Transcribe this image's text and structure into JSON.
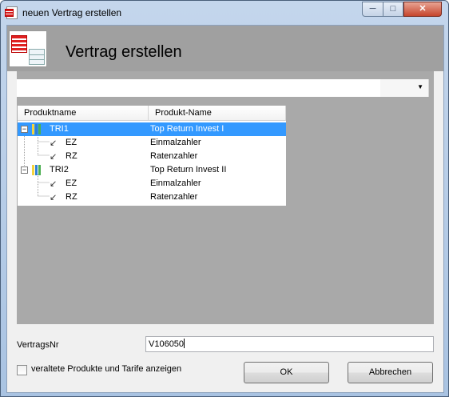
{
  "window": {
    "title": "neuen Vertrag erstellen",
    "controls": {
      "minimize": "─",
      "maximize": "□",
      "close": "✕"
    }
  },
  "header": {
    "title": "Vertrag erstellen"
  },
  "combo": {
    "value": "",
    "arrow": "▼"
  },
  "tree": {
    "columns": [
      "Produktname",
      "Produkt-Name"
    ],
    "rows": [
      {
        "name": "TRI1",
        "desc": "Top Return Invest I",
        "level": 0,
        "expander": "−",
        "selected": true
      },
      {
        "name": "EZ",
        "desc": "Einmalzahler",
        "level": 1
      },
      {
        "name": "RZ",
        "desc": "Ratenzahler",
        "level": 1
      },
      {
        "name": "TRI2",
        "desc": "Top Return Invest II",
        "level": 0,
        "expander": "−",
        "selected": false
      },
      {
        "name": "EZ",
        "desc": "Einmalzahler",
        "level": 1
      },
      {
        "name": "RZ",
        "desc": "Ratenzahler",
        "level": 1
      }
    ]
  },
  "form": {
    "vertragsnr_label": "VertragsNr",
    "vertragsnr_value": "V106050",
    "checkbox_label": "veraltete Produkte und Tarife anzeigen",
    "ok_label": "OK",
    "cancel_label": "Abbrechen"
  },
  "icons": {
    "app": "contract-document-icon",
    "product": "product-folder-icon",
    "tariff": "tariff-leaf-icon"
  },
  "colors": {
    "selection": "#3399ff",
    "header_bg": "#a0a0a0",
    "panel_bg": "#a9a9a9"
  }
}
